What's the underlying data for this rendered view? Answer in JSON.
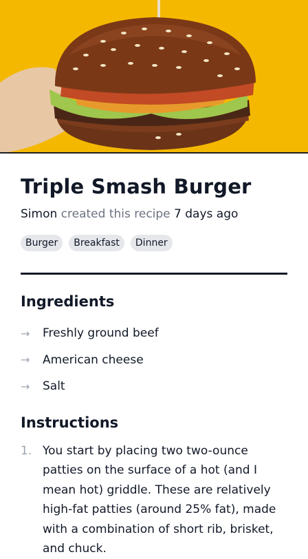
{
  "hero": {
    "image": "burger-photo"
  },
  "recipe": {
    "title": "Triple Smash Burger",
    "author": "Simon",
    "created_text": "created this recipe",
    "time_ago": "7 days ago",
    "tags": [
      "Burger",
      "Breakfast",
      "Dinner"
    ]
  },
  "ingredients": {
    "heading": "Ingredients",
    "items": [
      "Freshly ground beef",
      "American cheese",
      "Salt"
    ]
  },
  "instructions": {
    "heading": "Instructions",
    "steps": [
      {
        "number": "1.",
        "text": "You start by placing two two-ounce patties on the surface of a hot (and I mean hot) griddle. These are relatively high-fat patties (around 25% fat), made with a combination of short rib, brisket, and chuck."
      }
    ]
  },
  "colors": {
    "hero_bg": "#f5b800",
    "text": "#111827",
    "muted": "#6b7280",
    "tag_bg": "#e5e7eb"
  }
}
